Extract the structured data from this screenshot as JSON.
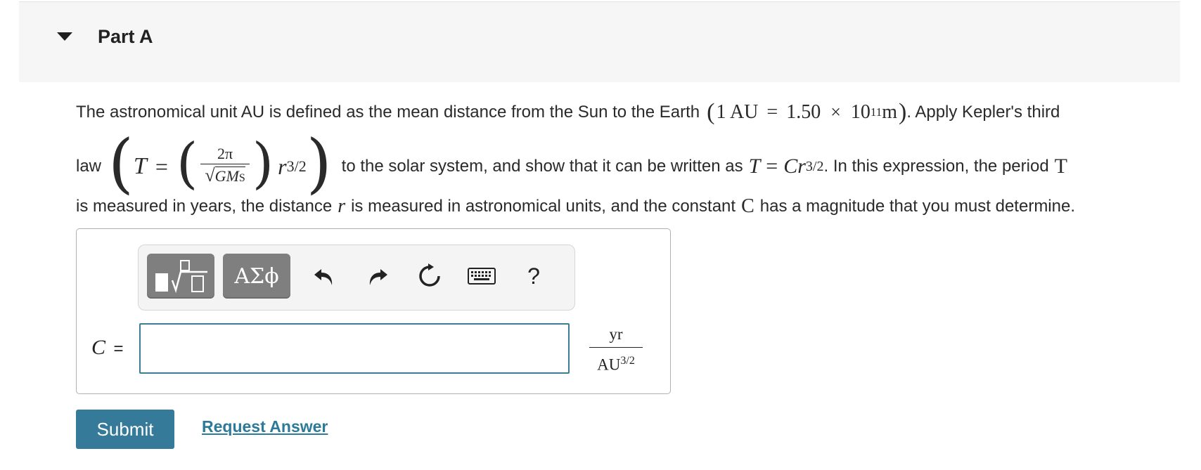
{
  "part": {
    "title": "Part A"
  },
  "problem": {
    "line1_text": "The astronomical unit AU is defined as the mean distance from the Sun to the Earth",
    "au_lhs": "1 AU",
    "au_eq": "=",
    "au_val": "1.50",
    "au_times": "×",
    "au_base": "10",
    "au_exp": "11",
    "au_unit": "m",
    "line1_end": ". Apply Kepler's third",
    "law": "law",
    "kepler_T": "T",
    "kepler_eq": "=",
    "kepler_num": "2π",
    "kepler_den_G": "GM",
    "kepler_den_sub": "S",
    "kepler_r": "r",
    "kepler_exp": "3/2",
    "line2_mid": "to the solar system, and show that it can be written as",
    "form_T": "T",
    "form_eq": "=",
    "form_C": "C",
    "form_r": "r",
    "form_exp": "3/2",
    "line2_end": ". In this expression, the period",
    "period_T": "T",
    "line3_a": "is measured in years, the distance",
    "line3_r": "r",
    "line3_b": "is measured in astronomical units, and the constant",
    "line3_C": "C",
    "line3_c": "has a magnitude that you must determine."
  },
  "toolbar": {
    "symbols_label": "ΑΣϕ",
    "help_label": "?"
  },
  "answer": {
    "variable": "C",
    "equals": "=",
    "value": "",
    "unit_num": "yr",
    "unit_den_base": "AU",
    "unit_den_exp": "3/2"
  },
  "actions": {
    "submit_label": "Submit",
    "request_label": "Request Answer"
  },
  "colors": {
    "accent": "#357a98",
    "link": "#2c7a9a",
    "header_bg": "#f6f6f6",
    "button_gray": "#7f7f7f"
  }
}
